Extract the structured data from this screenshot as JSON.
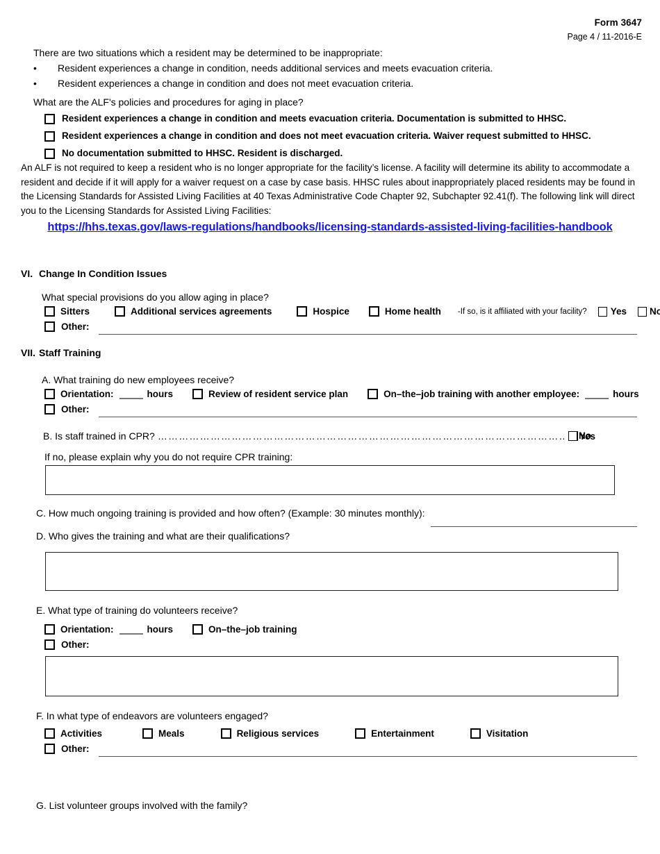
{
  "header": {
    "form_number": "Form 3647",
    "page_info": "Page 4  / 11-2016-E"
  },
  "intro": {
    "lead": "There are two situations which a resident may be determined to be inappropriate:",
    "bullet_marker": "•",
    "bullets": [
      "Resident experiences a change in condition, needs additional services and meets evacuation criteria.",
      "Resident experiences a change in condition and does not meet evacuation criteria."
    ],
    "question": "What are the ALF's policies and procedures for aging in place?",
    "options": [
      "Resident experiences a change in condition and meets evacuation criteria. Documentation is submitted to HHSC.",
      "Resident experiences a change in condition and does not meet evacuation criteria. Waiver request submitted to HHSC.",
      "No documentation submitted to HHSC. Resident is discharged."
    ],
    "paragraph": "An ALF is not required to keep a resident who is no longer appropriate for the facility’s license.  A facility will determine its ability to accommodate a resident and decide if it will apply for a waiver request on a case by case basis. HHSC rules about inappropriately placed residents may be found in the Licensing Standards for Assisted Living Facilities at 40 Texas Administrative Code Chapter 92, Subchapter 92.41(f). The following link will direct you to the Licensing Standards for Assisted Living Facilities:",
    "link_text": "https://hhs.texas.gov/laws-regulations/handbooks/licensing-standards-assisted-living-facilities-handbook",
    "link_color": "#1a1ae6"
  },
  "section_vi": {
    "number": "VI.",
    "title": "Change In Condition Issues",
    "question": "What special provisions do you allow aging in place?",
    "options": [
      "Sitters",
      "Additional services agreements",
      "Hospice",
      "Home health"
    ],
    "affiliation_note": "-If so, is it affiliated with your facility?",
    "yes_label": "Yes",
    "no_label": "No",
    "other_label": "Other:"
  },
  "section_vii": {
    "number": "VII.",
    "title": "Staff Training",
    "item_a": {
      "question": "A. What training do new employees receive?",
      "orientation_label": "Orientation:",
      "orientation_hours": "hours",
      "review_label": "Review of resident service plan",
      "ojt_label": "On–the–job training with another employee:",
      "ojt_hours": "hours",
      "other_label": "Other:"
    },
    "item_b": {
      "question": "B. Is staff trained in CPR?",
      "leader": "…………………………………………………………………………………………………………………………",
      "yes_label": "Yes",
      "no_label": "No",
      "followup": "If no, please explain why you do not require CPR training:"
    },
    "item_c": {
      "question": "C. How much ongoing training is provided and how often? (Example: 30 minutes monthly):"
    },
    "item_d": {
      "question": "D. Who gives the training and what are their qualifications?"
    },
    "item_e": {
      "question": "E. What type of training do volunteers receive?",
      "orientation_label": "Orientation:",
      "orientation_hours": "hours",
      "ojt_label": "On–the–job training",
      "other_label": "Other:"
    },
    "item_f": {
      "question": "F. In what type of endeavors are volunteers engaged?",
      "options": [
        "Activities",
        "Meals",
        "Religious services",
        "Entertainment",
        "Visitation"
      ],
      "other_label": "Other:"
    },
    "item_g": {
      "question": "G. List volunteer groups involved with the family?"
    }
  }
}
